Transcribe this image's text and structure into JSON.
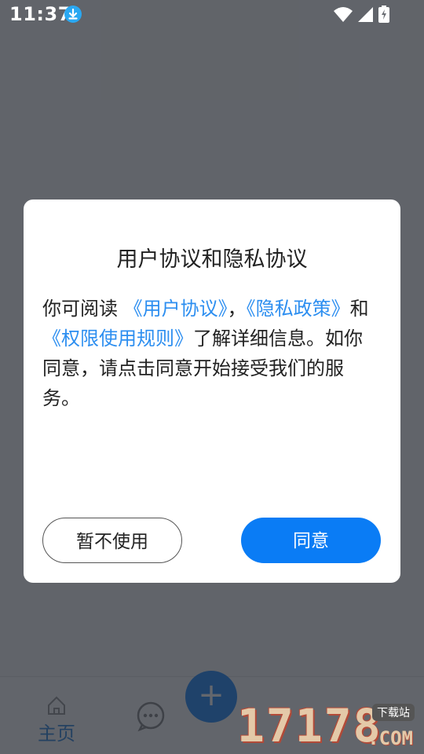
{
  "status": {
    "time": "11:37",
    "icons": [
      "download-icon",
      "wifi-icon",
      "signal-icon",
      "battery-charging-icon"
    ]
  },
  "dialog": {
    "title": "用户协议和隐私协议",
    "body": {
      "p1": "你可阅读 ",
      "link_user": "《用户协议》",
      "sep": "，",
      "link_privacy": "《隐私政策》",
      "p2": "和",
      "link_permission": "《权限使用规则》",
      "p3": "了解详细信息。如你同意，请点击同意开始接受我们的服务。"
    },
    "decline_label": "暂不使用",
    "agree_label": "同意"
  },
  "bottom_nav": {
    "home_label": "主页",
    "icons": [
      "home-icon",
      "chat-icon",
      "add-icon"
    ]
  },
  "watermark": {
    "digits": "17178",
    "badge": "下载站",
    "suffix": ".COM"
  },
  "colors": {
    "accent": "#0a7cf5",
    "link": "#2c8ef0",
    "overlay": "#282c34"
  }
}
